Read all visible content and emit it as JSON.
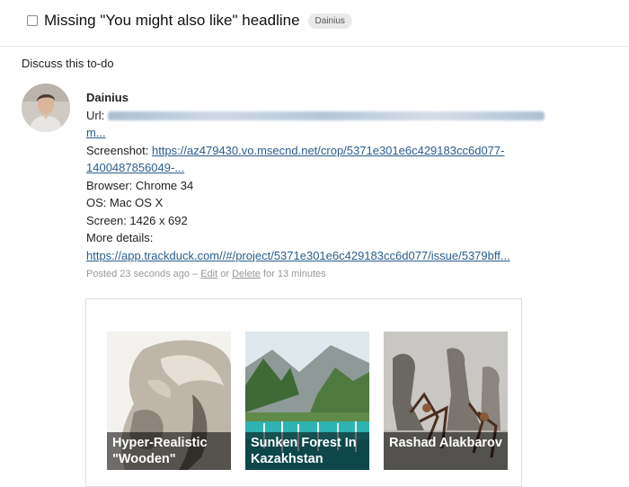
{
  "todo": {
    "title": "Missing \"You might also like\" headline",
    "tag": "Dainius"
  },
  "discussion": {
    "heading": "Discuss this to-do"
  },
  "comment": {
    "author": "Dainius",
    "url_label": "Url:",
    "url_tail": "m...",
    "screenshot_label": "Screenshot:",
    "screenshot_link_1": "https://az479430.vo.msecnd.net/crop/5371e301e6c429183cc6d077-",
    "screenshot_link_2": "1400487856049-...",
    "browser": "Browser: Chrome 34",
    "os": "OS: Mac OS X",
    "screen": "Screen: 1426 x 692",
    "more_details_label": "More details:",
    "more_details_link": "https://app.trackduck.com//#/project/5371e301e6c429183cc6d077/issue/5379bff...",
    "meta": {
      "posted": "Posted 23 seconds ago",
      "sep": " – ",
      "edit": "Edit",
      "or": " or ",
      "delete": "Delete",
      "for": " for 13 minutes"
    }
  },
  "recommendations": [
    {
      "title": "Hyper-Realistic \"Wooden\"",
      "image": "sculpture-photo"
    },
    {
      "title": "Sunken Forest In Kazakhstan",
      "image": "lake-forest-photo"
    },
    {
      "title": "Rashad Alakbarov",
      "image": "shadow-art-photo"
    }
  ],
  "colors": {
    "link": "#2a5d8c",
    "meta": "#999999",
    "caption_overlay": "#000000"
  }
}
